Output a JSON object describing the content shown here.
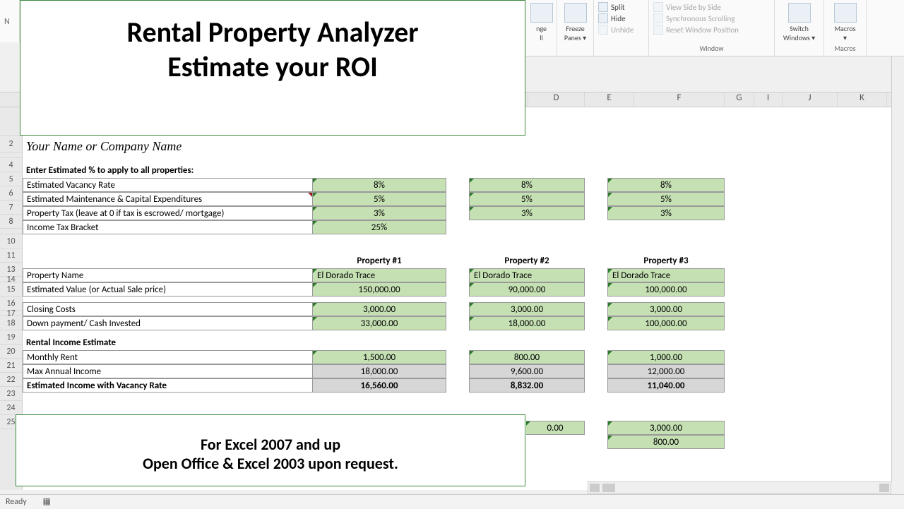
{
  "title": {
    "line1": "Rental Property Analyzer",
    "line2": "Estimate your ROI"
  },
  "footer": {
    "line1": "For Excel 2007 and up",
    "line2": "Open Office & Excel 2003 upon request."
  },
  "ribbon": {
    "arrange_all": "nge\nll",
    "freeze": "Freeze\nPanes ▾",
    "split": "Split",
    "hide": "Hide",
    "unhide": "Unhide",
    "side_by_side": "View Side by Side",
    "sync": "Synchronous Scrolling",
    "reset": "Reset Window Position",
    "switch": "Switch\nWindows ▾",
    "macros": "Macros\n▾",
    "group_window": "Window",
    "group_macros": "Macros"
  },
  "col_letters": [
    "D",
    "E",
    "F",
    "G",
    "I",
    "J",
    "K"
  ],
  "status": "Ready",
  "rows": {
    "company": "Your Name or Company Name",
    "enter_pct": "Enter Estimated % to apply to all properties:",
    "vacancy": "Estimated Vacancy Rate",
    "maint": "Estimated Maintenance & Capital Expenditures",
    "proptax": "Property Tax (leave at 0 if tax is escrowed/ mortgage)",
    "itb": "Income Tax Bracket",
    "prop_hdrs": [
      "Property #1",
      "Property #2",
      "Property #3"
    ],
    "propname": "Property Name",
    "estval": "Estimated Value (or Actual Sale price)",
    "closing": "Closing Costs",
    "down": "Down payment/ Cash Invested",
    "rie": "Rental Income Estimate",
    "mrent": "Monthly Rent",
    "maxinc": "Max Annual Income",
    "estinc": "Estimated Income with Vacancy Rate"
  },
  "data": {
    "vacancy": [
      "8%",
      "8%",
      "8%"
    ],
    "maint": [
      "5%",
      "5%",
      "5%"
    ],
    "proptax": [
      "3%",
      "3%",
      "3%"
    ],
    "itb": [
      "25%",
      "",
      ""
    ],
    "propname": [
      "El Dorado Trace",
      "El Dorado Trace",
      "El Dorado Trace"
    ],
    "estval": [
      "150,000.00",
      "90,000.00",
      "100,000.00"
    ],
    "closing": [
      "3,000.00",
      "3,000.00",
      "3,000.00"
    ],
    "down": [
      "33,000.00",
      "18,000.00",
      "100,000.00"
    ],
    "mrent": [
      "1,500.00",
      "800.00",
      "1,000.00"
    ],
    "maxinc": [
      "18,000.00",
      "9,600.00",
      "12,000.00"
    ],
    "estinc": [
      "16,560.00",
      "8,832.00",
      "11,040.00"
    ],
    "row24": [
      "0.00",
      "3,000.00"
    ],
    "row25": [
      "800.00"
    ]
  }
}
